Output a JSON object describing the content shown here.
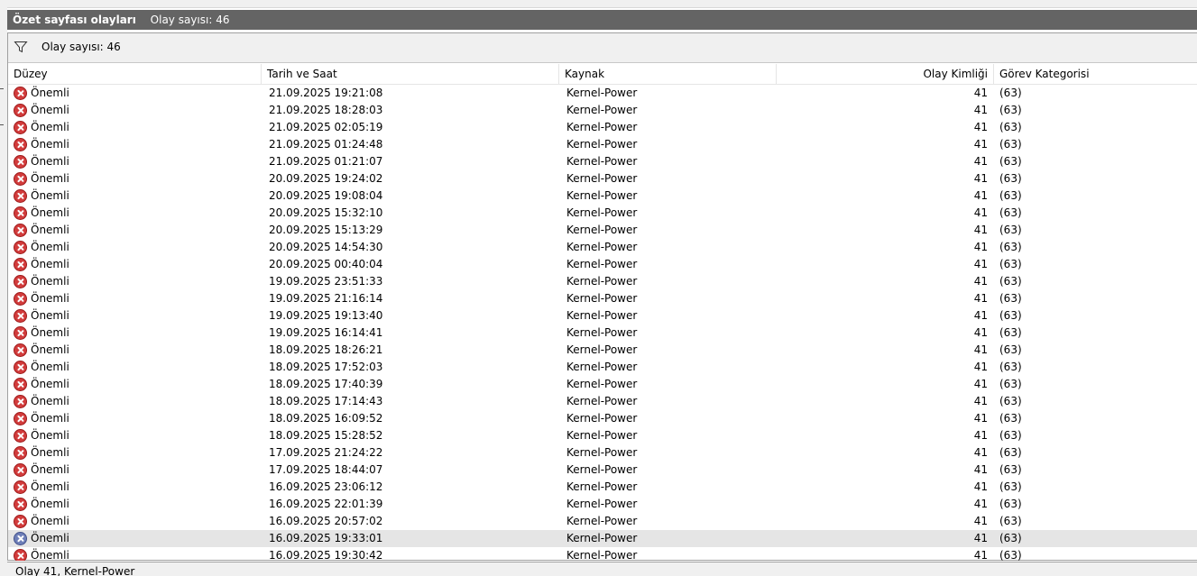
{
  "panel": {
    "title": "Özet sayfası olayları",
    "count_label": "Olay sayısı: 46"
  },
  "filter": {
    "icon": "filter-icon",
    "text": "Olay sayısı: 46"
  },
  "columns": [
    "Düzey",
    "Tarih ve Saat",
    "Kaynak",
    "Olay Kimliği",
    "Görev Kategorisi"
  ],
  "rows": [
    {
      "level": "Önemli",
      "date": "21.09.2025 19:21:08",
      "source": "Kernel-Power",
      "id": "41",
      "category": "(63)"
    },
    {
      "level": "Önemli",
      "date": "21.09.2025 18:28:03",
      "source": "Kernel-Power",
      "id": "41",
      "category": "(63)"
    },
    {
      "level": "Önemli",
      "date": "21.09.2025 02:05:19",
      "source": "Kernel-Power",
      "id": "41",
      "category": "(63)"
    },
    {
      "level": "Önemli",
      "date": "21.09.2025 01:24:48",
      "source": "Kernel-Power",
      "id": "41",
      "category": "(63)"
    },
    {
      "level": "Önemli",
      "date": "21.09.2025 01:21:07",
      "source": "Kernel-Power",
      "id": "41",
      "category": "(63)"
    },
    {
      "level": "Önemli",
      "date": "20.09.2025 19:24:02",
      "source": "Kernel-Power",
      "id": "41",
      "category": "(63)"
    },
    {
      "level": "Önemli",
      "date": "20.09.2025 19:08:04",
      "source": "Kernel-Power",
      "id": "41",
      "category": "(63)"
    },
    {
      "level": "Önemli",
      "date": "20.09.2025 15:32:10",
      "source": "Kernel-Power",
      "id": "41",
      "category": "(63)"
    },
    {
      "level": "Önemli",
      "date": "20.09.2025 15:13:29",
      "source": "Kernel-Power",
      "id": "41",
      "category": "(63)"
    },
    {
      "level": "Önemli",
      "date": "20.09.2025 14:54:30",
      "source": "Kernel-Power",
      "id": "41",
      "category": "(63)"
    },
    {
      "level": "Önemli",
      "date": "20.09.2025 00:40:04",
      "source": "Kernel-Power",
      "id": "41",
      "category": "(63)"
    },
    {
      "level": "Önemli",
      "date": "19.09.2025 23:51:33",
      "source": "Kernel-Power",
      "id": "41",
      "category": "(63)"
    },
    {
      "level": "Önemli",
      "date": "19.09.2025 21:16:14",
      "source": "Kernel-Power",
      "id": "41",
      "category": "(63)"
    },
    {
      "level": "Önemli",
      "date": "19.09.2025 19:13:40",
      "source": "Kernel-Power",
      "id": "41",
      "category": "(63)"
    },
    {
      "level": "Önemli",
      "date": "19.09.2025 16:14:41",
      "source": "Kernel-Power",
      "id": "41",
      "category": "(63)"
    },
    {
      "level": "Önemli",
      "date": "18.09.2025 18:26:21",
      "source": "Kernel-Power",
      "id": "41",
      "category": "(63)"
    },
    {
      "level": "Önemli",
      "date": "18.09.2025 17:52:03",
      "source": "Kernel-Power",
      "id": "41",
      "category": "(63)"
    },
    {
      "level": "Önemli",
      "date": "18.09.2025 17:40:39",
      "source": "Kernel-Power",
      "id": "41",
      "category": "(63)"
    },
    {
      "level": "Önemli",
      "date": "18.09.2025 17:14:43",
      "source": "Kernel-Power",
      "id": "41",
      "category": "(63)"
    },
    {
      "level": "Önemli",
      "date": "18.09.2025 16:09:52",
      "source": "Kernel-Power",
      "id": "41",
      "category": "(63)"
    },
    {
      "level": "Önemli",
      "date": "18.09.2025 15:28:52",
      "source": "Kernel-Power",
      "id": "41",
      "category": "(63)"
    },
    {
      "level": "Önemli",
      "date": "17.09.2025 21:24:22",
      "source": "Kernel-Power",
      "id": "41",
      "category": "(63)"
    },
    {
      "level": "Önemli",
      "date": "17.09.2025 18:44:07",
      "source": "Kernel-Power",
      "id": "41",
      "category": "(63)"
    },
    {
      "level": "Önemli",
      "date": "16.09.2025 23:06:12",
      "source": "Kernel-Power",
      "id": "41",
      "category": "(63)"
    },
    {
      "level": "Önemli",
      "date": "16.09.2025 22:01:39",
      "source": "Kernel-Power",
      "id": "41",
      "category": "(63)"
    },
    {
      "level": "Önemli",
      "date": "16.09.2025 20:57:02",
      "source": "Kernel-Power",
      "id": "41",
      "category": "(63)"
    },
    {
      "level": "Önemli",
      "date": "16.09.2025 19:33:01",
      "source": "Kernel-Power",
      "id": "41",
      "category": "(63)",
      "selected": true
    },
    {
      "level": "Önemli",
      "date": "16.09.2025 19:30:42",
      "source": "Kernel-Power",
      "id": "41",
      "category": "(63)"
    }
  ],
  "statusbar": {
    "text": "Olay 41, Kernel-Power"
  },
  "colors": {
    "titlebar_bg": "#646464",
    "critical_icon": "#d23c3c",
    "selected_row_bg": "#e5e5e5"
  }
}
